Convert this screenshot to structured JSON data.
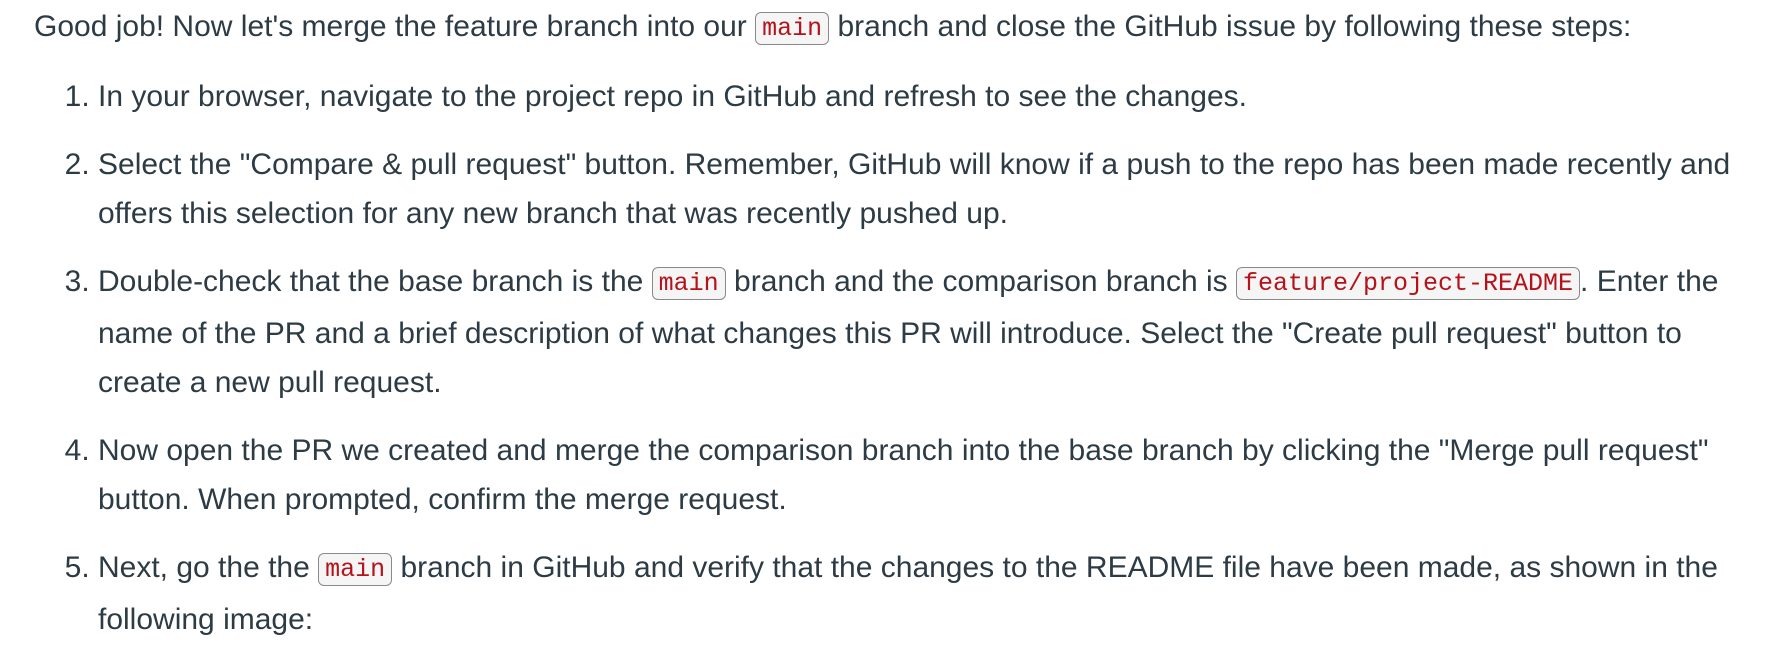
{
  "intro": {
    "before": "Good job! Now let's merge the feature branch into our ",
    "code": "main",
    "after": " branch and close the GitHub issue by following these steps:"
  },
  "steps": [
    {
      "text": "In your browser, navigate to the project repo in GitHub and refresh to see the changes."
    },
    {
      "text": "Select the \"Compare & pull request\" button. Remember, GitHub will know if a push to the repo has been made recently and offers this selection for any new branch that was recently pushed up."
    },
    {
      "part1": "Double-check that the base branch is the ",
      "code1": "main",
      "part2": " branch and the comparison branch is ",
      "code2": "feature/project-README",
      "part3": ". Enter the name of the PR and a brief description of what changes this PR will introduce. Select the \"Create pull request\" button to create a new pull request."
    },
    {
      "text": "Now open the PR we created and merge the comparison branch into the base branch by clicking the \"Merge pull request\" button. When prompted, confirm the merge request."
    },
    {
      "part1": "Next, go the the ",
      "code1": "main",
      "part2": " branch in GitHub and verify that the changes to the README file have been made, as shown in the following image:"
    }
  ]
}
